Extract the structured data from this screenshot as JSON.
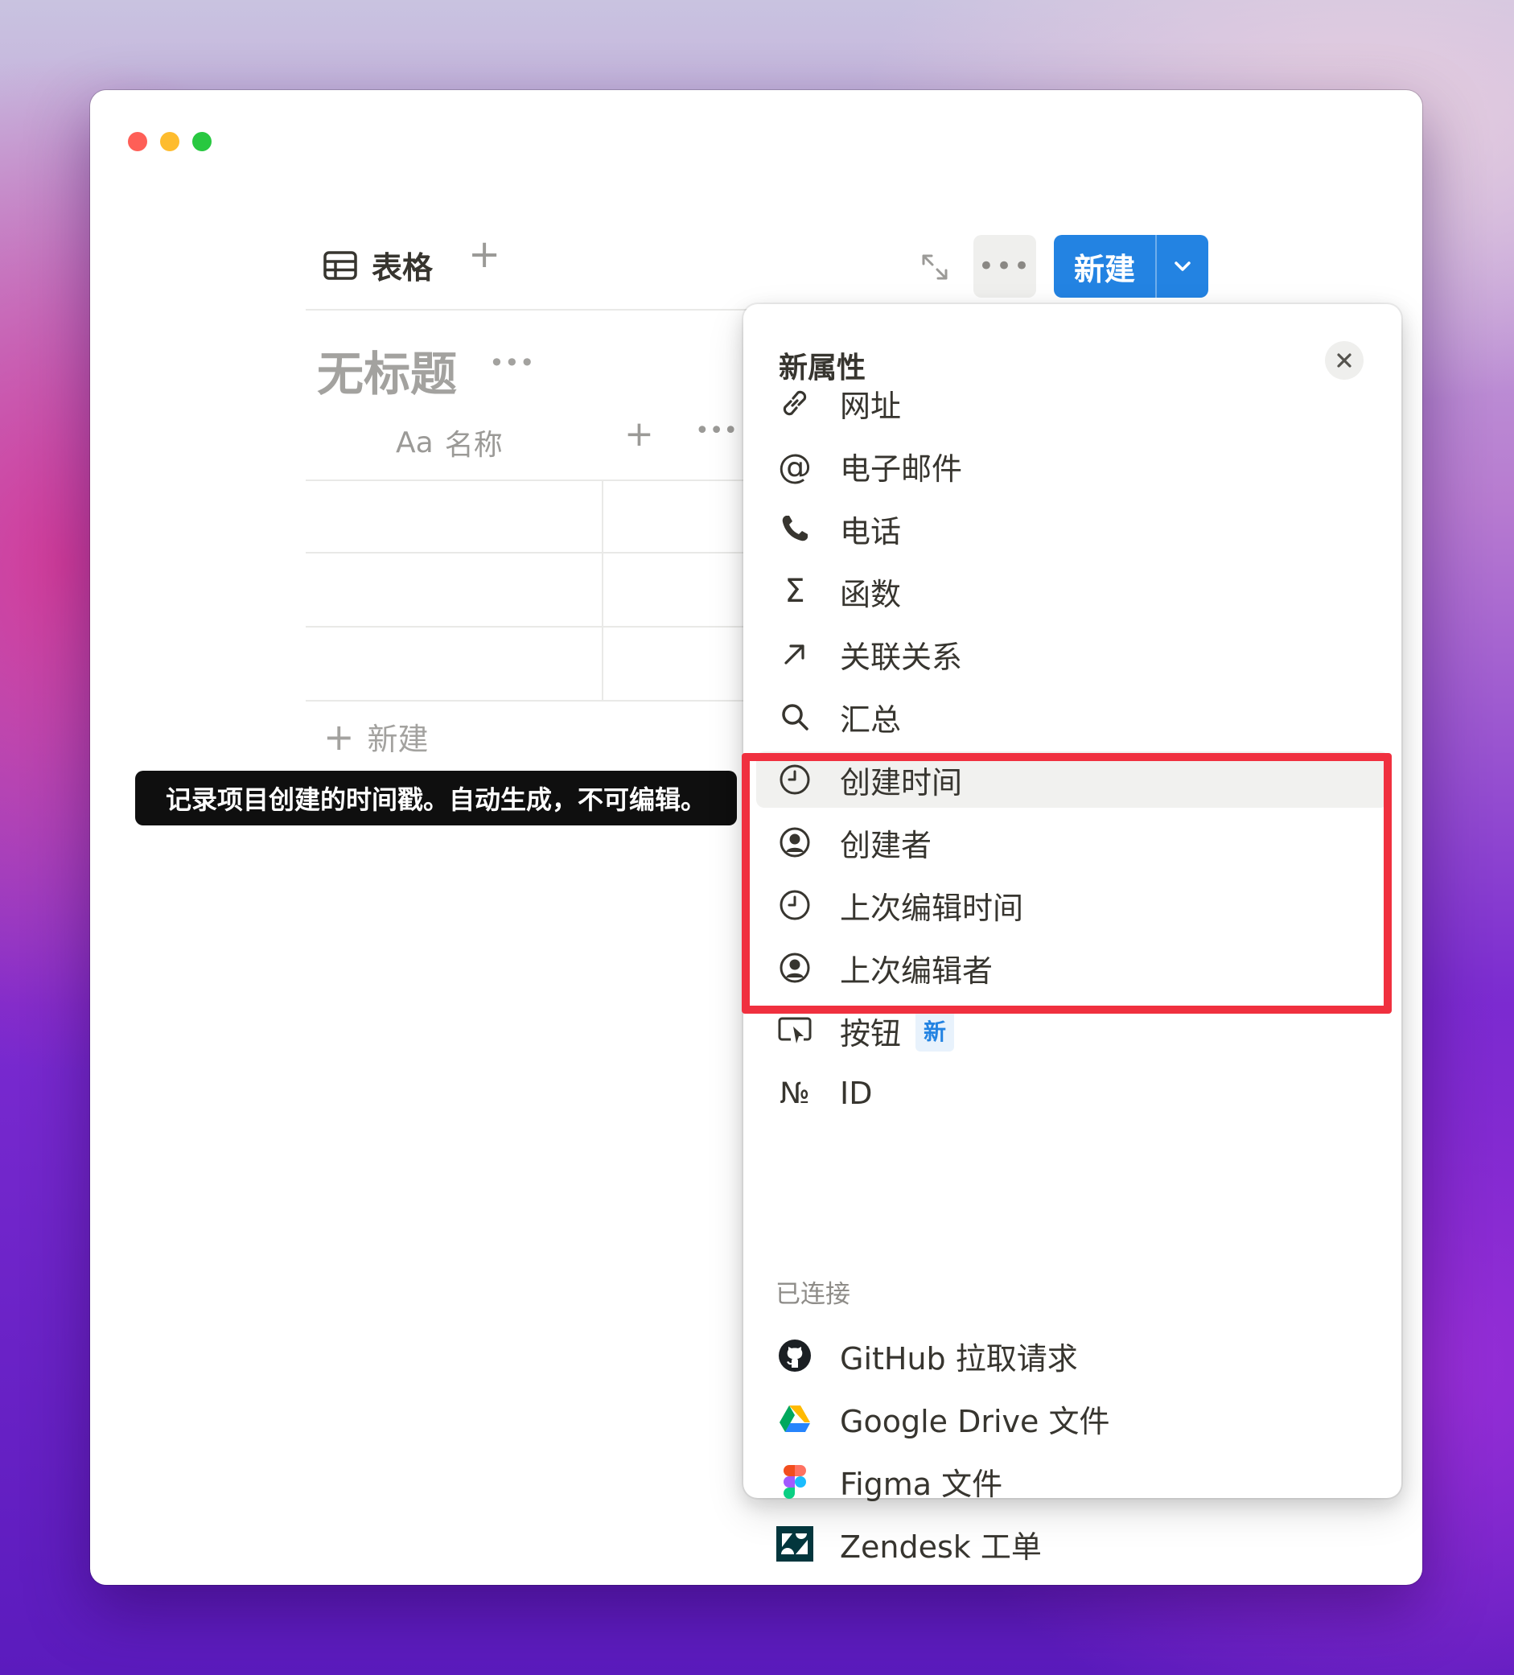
{
  "window": {
    "controls": [
      "close",
      "minimize",
      "zoom"
    ]
  },
  "toolbar": {
    "view_tab_label": "表格",
    "add_view_label": "+",
    "more_label": "•••",
    "new_button_label": "新建"
  },
  "database": {
    "title": "无标题",
    "title_more_label": "•••",
    "column_header_prefix": "Aa",
    "column_header_label": "名称",
    "add_column_label": "+",
    "column_more_label": "•••",
    "add_row_label": "新建",
    "add_row_plus": "+"
  },
  "tooltip": {
    "text": "记录项目创建的时间戳。自动生成，不可编辑。"
  },
  "menu": {
    "title": "新属性",
    "items": [
      {
        "label": "网址",
        "icon": "link-icon"
      },
      {
        "label": "电子邮件",
        "icon": "at-icon"
      },
      {
        "label": "电话",
        "icon": "phone-icon"
      },
      {
        "label": "函数",
        "icon": "sigma-icon"
      },
      {
        "label": "关联关系",
        "icon": "arrow-up-right-icon"
      },
      {
        "label": "汇总",
        "icon": "search-icon"
      },
      {
        "label": "创建时间",
        "icon": "clock-icon"
      },
      {
        "label": "创建者",
        "icon": "user-circle-icon"
      },
      {
        "label": "上次编辑时间",
        "icon": "clock-icon"
      },
      {
        "label": "上次编辑者",
        "icon": "user-circle-icon"
      },
      {
        "label": "按钮",
        "icon": "cursor-button-icon",
        "badge": "新"
      },
      {
        "label": "ID",
        "icon": "numero-icon",
        "icon_text": "№"
      }
    ],
    "connected_section_label": "已连接",
    "connected_items": [
      {
        "label": "GitHub 拉取请求",
        "icon": "github-icon"
      },
      {
        "label": "Google Drive 文件",
        "icon": "google-drive-icon"
      },
      {
        "label": "Figma 文件",
        "icon": "figma-icon"
      },
      {
        "label": "Zendesk 工单",
        "icon": "zendesk-icon"
      }
    ]
  },
  "colors": {
    "accent": "#2383e2",
    "highlight": "#f0303f",
    "tooltip_bg": "#0f0f0f"
  }
}
